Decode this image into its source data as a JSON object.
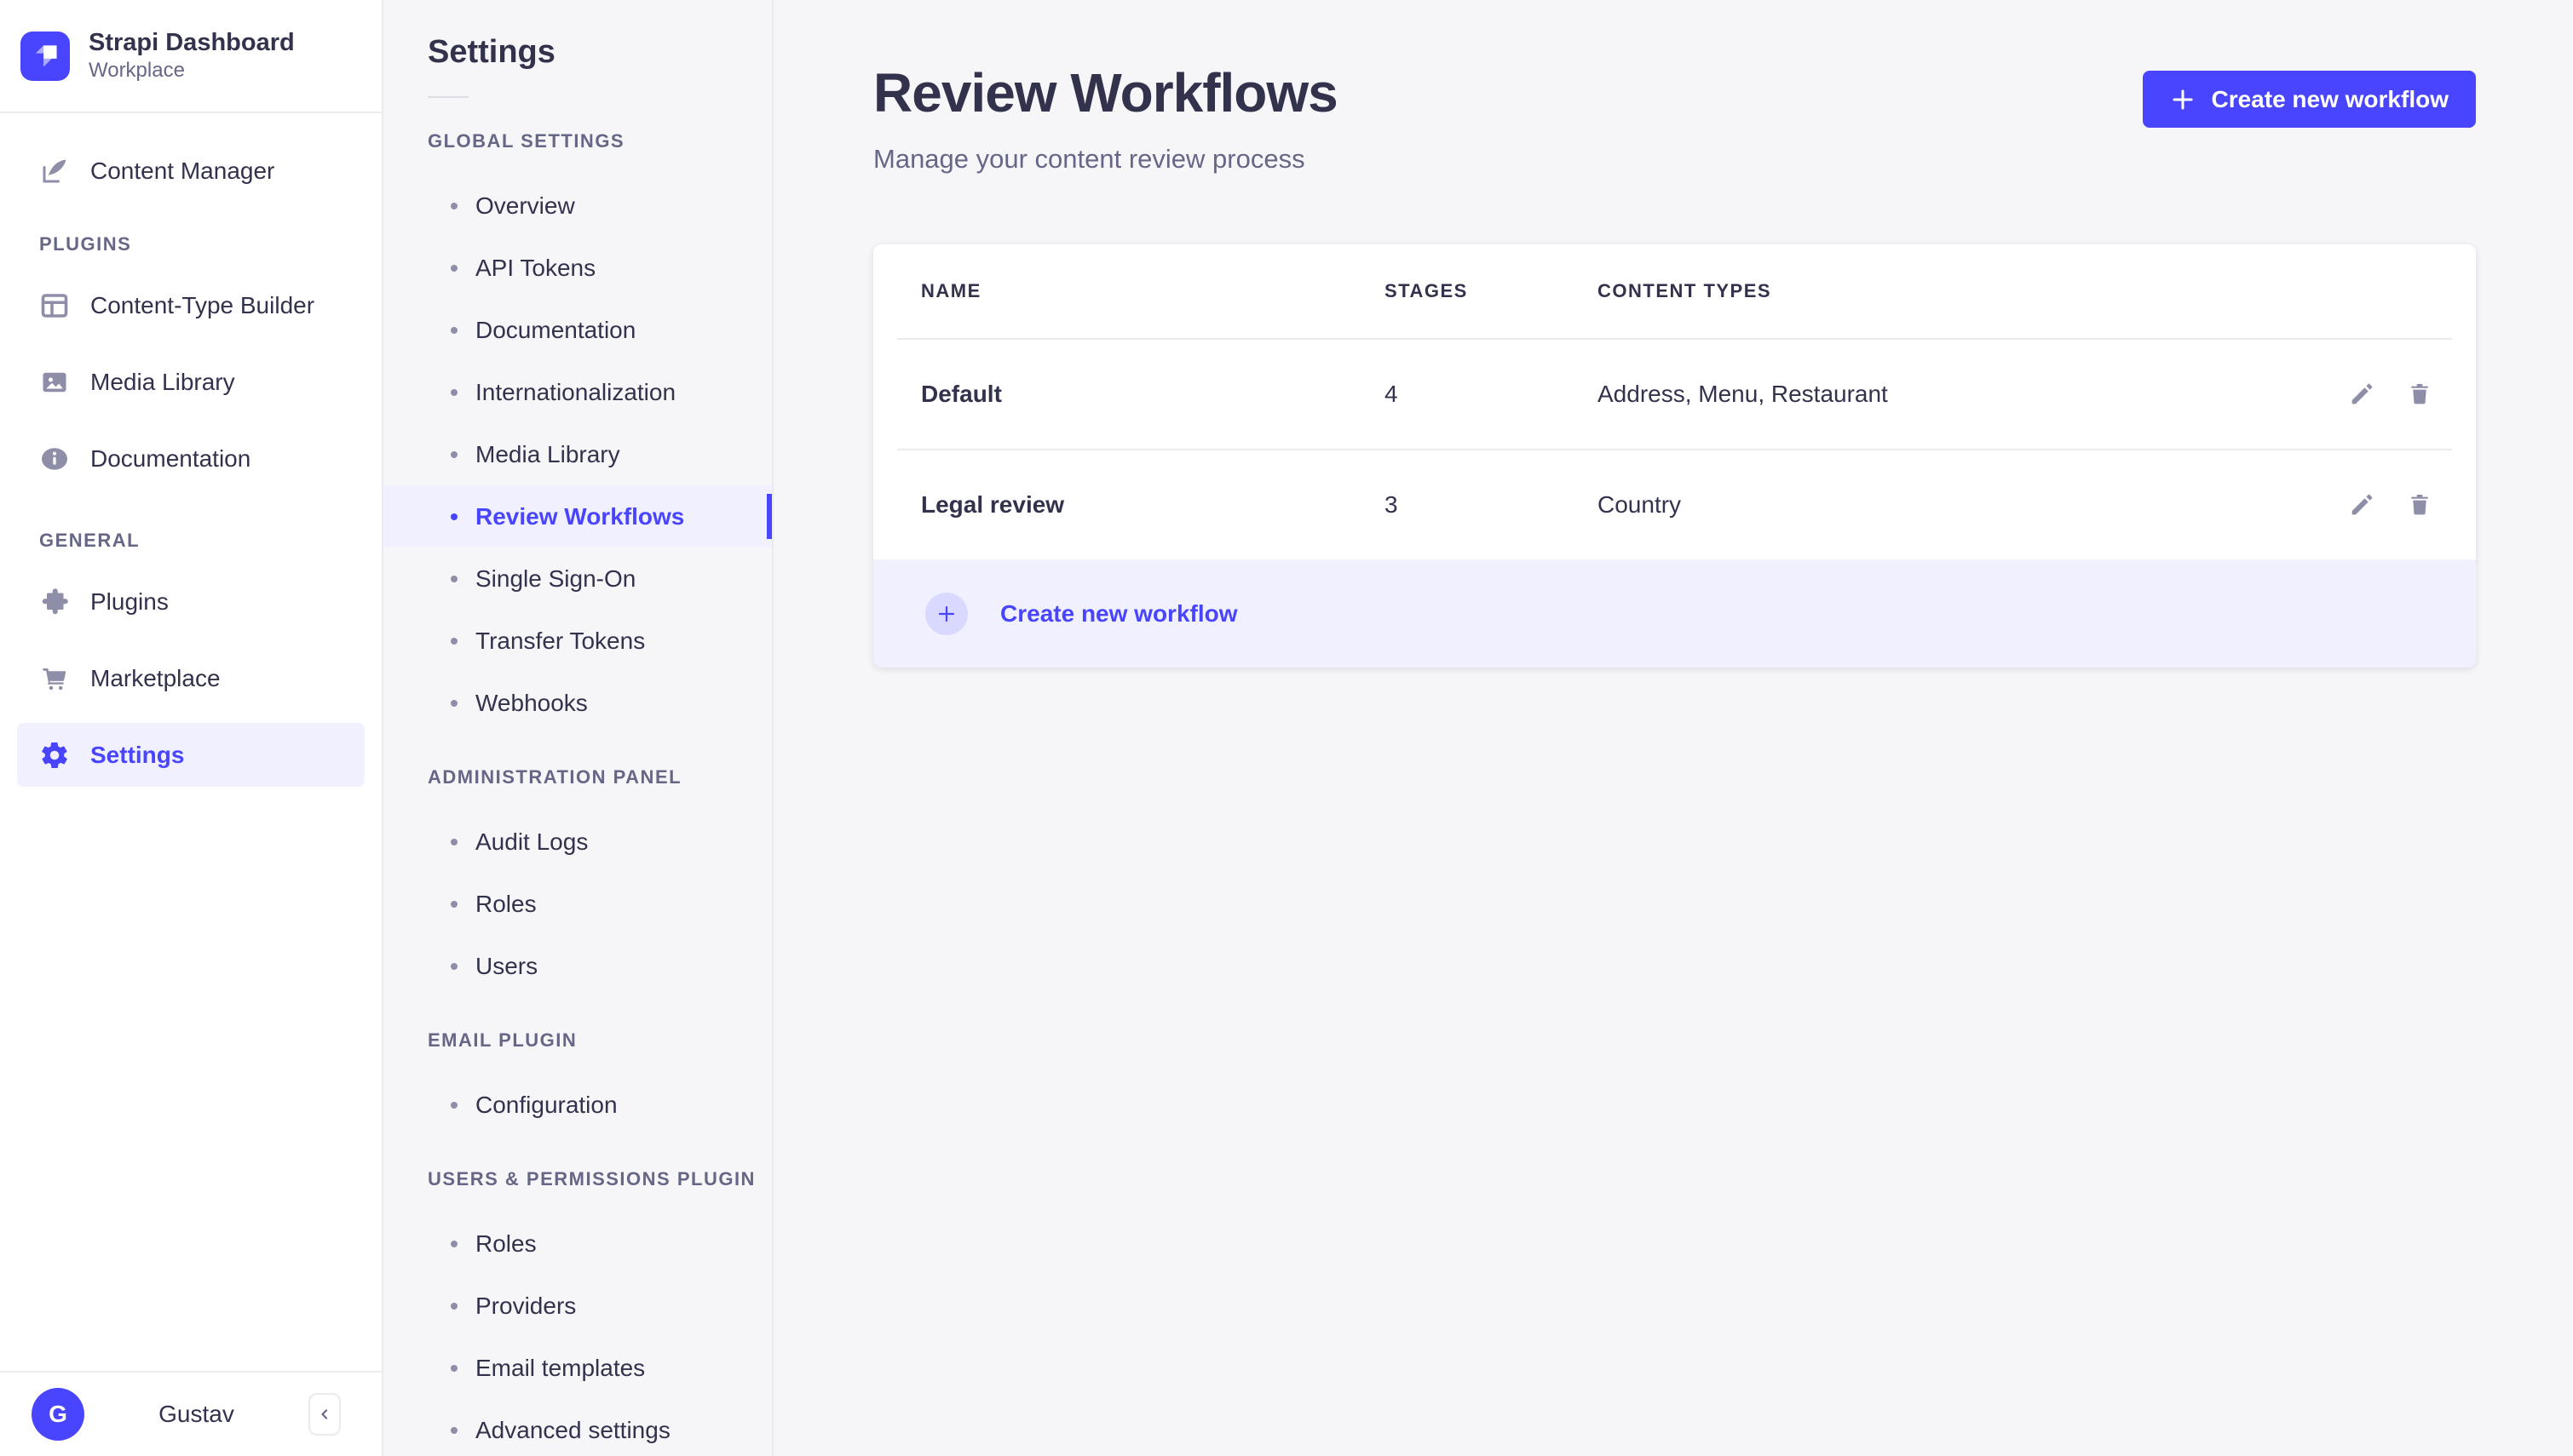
{
  "colors": {
    "primary": "#4945ff",
    "primary_light_bg": "#f0f0ff",
    "plus_circle_bg": "#d9d8ff",
    "border": "#eaeaef",
    "text_dark": "#32324d",
    "text_muted": "#666687",
    "icon_gray": "#8e8ea9",
    "page_bg": "#f6f6f9"
  },
  "sidebar": {
    "brand": {
      "name": "Strapi Dashboard",
      "workspace": "Workplace",
      "logo_icon": "strapi-logo-icon"
    },
    "content_manager": {
      "label": "Content Manager",
      "icon": "feather-pen-icon"
    },
    "sections": [
      {
        "label": "PLUGINS",
        "items": [
          {
            "label": "Content-Type Builder",
            "icon": "layout-grid-icon"
          },
          {
            "label": "Media Library",
            "icon": "image-icon"
          },
          {
            "label": "Documentation",
            "icon": "info-icon"
          }
        ]
      },
      {
        "label": "GENERAL",
        "items": [
          {
            "label": "Plugins",
            "icon": "puzzle-icon"
          },
          {
            "label": "Marketplace",
            "icon": "cart-icon"
          },
          {
            "label": "Settings",
            "icon": "gear-icon",
            "selected": true
          }
        ]
      }
    ],
    "user": {
      "initial": "G",
      "name": "Gustav"
    },
    "collapse_button_icon": "chevron-left-icon"
  },
  "subnav": {
    "title": "Settings",
    "sections": [
      {
        "label": "GLOBAL SETTINGS",
        "items": [
          "Overview",
          "API Tokens",
          "Documentation",
          "Internationalization",
          "Media Library",
          "Review Workflows",
          "Single Sign-On",
          "Transfer Tokens",
          "Webhooks"
        ],
        "selected_item": "Review Workflows"
      },
      {
        "label": "ADMINISTRATION PANEL",
        "items": [
          "Audit Logs",
          "Roles",
          "Users"
        ]
      },
      {
        "label": "EMAIL PLUGIN",
        "items": [
          "Configuration"
        ]
      },
      {
        "label": "USERS & PERMISSIONS PLUGIN",
        "items": [
          "Roles",
          "Providers",
          "Email templates",
          "Advanced settings"
        ]
      }
    ]
  },
  "main": {
    "title": "Review Workflows",
    "subtitle": "Manage your content review process",
    "create_button_label": "Create new workflow",
    "table": {
      "headers": [
        "NAME",
        "STAGES",
        "CONTENT TYPES"
      ],
      "rows": [
        {
          "name": "Default",
          "stages": "4",
          "content_types": "Address, Menu, Restaurant"
        },
        {
          "name": "Legal review",
          "stages": "3",
          "content_types": "Country"
        }
      ],
      "row_action_icons": [
        "pencil-icon",
        "trash-icon"
      ],
      "footer_action_label": "Create new workflow"
    }
  }
}
